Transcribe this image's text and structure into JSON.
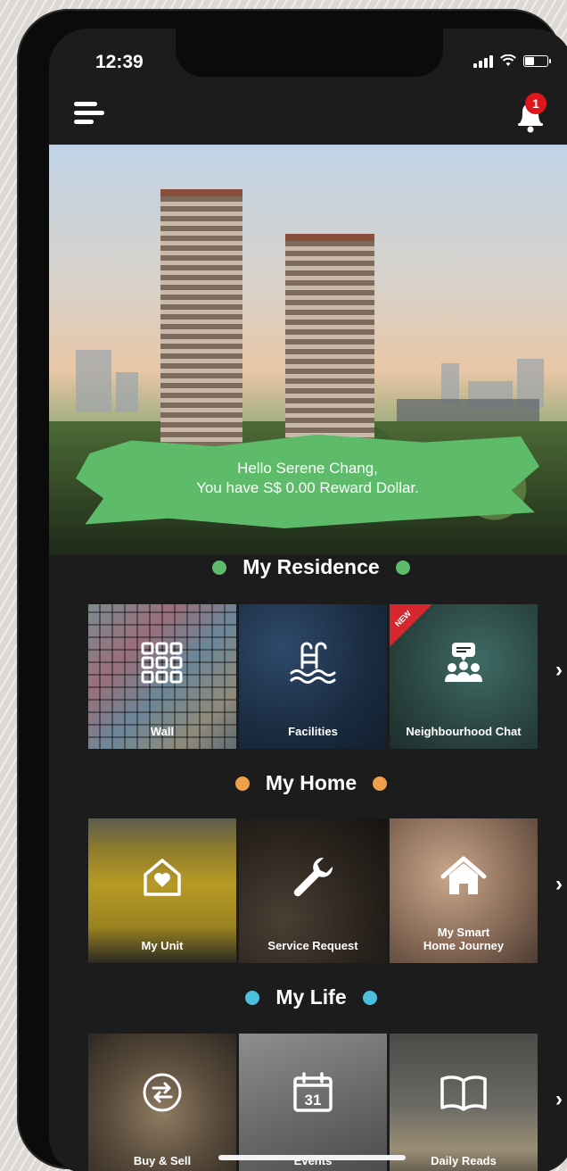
{
  "status_bar": {
    "time": "12:39"
  },
  "header": {
    "notification_count": "1"
  },
  "greeting": {
    "line1": "Hello Serene Chang,",
    "line2": "You have S$ 0.00 Reward Dollar."
  },
  "sections": [
    {
      "title": "My Residence",
      "dot_color": "#5dbb6a",
      "tiles": [
        {
          "label": "Wall",
          "icon": "grid-icon"
        },
        {
          "label": "Facilities",
          "icon": "pool-ladder-icon"
        },
        {
          "label": "Neighbourhood Chat",
          "icon": "chat-people-icon",
          "badge": "NEW"
        }
      ]
    },
    {
      "title": "My Home",
      "dot_color": "#f0a04a",
      "tiles": [
        {
          "label": "My Unit",
          "icon": "house-heart-icon"
        },
        {
          "label": "Service Request",
          "icon": "wrench-icon"
        },
        {
          "label": "My Smart\nHome Journey",
          "label_l1": "My Smart",
          "label_l2": "Home Journey",
          "icon": "house-icon"
        }
      ]
    },
    {
      "title": "My Life",
      "dot_color": "#4bc0dd",
      "tiles": [
        {
          "label": "Buy & Sell",
          "icon": "swap-icon"
        },
        {
          "label": "Events",
          "icon": "calendar-icon",
          "calendar_day": "31"
        },
        {
          "label": "Daily Reads",
          "icon": "book-icon"
        }
      ]
    }
  ]
}
